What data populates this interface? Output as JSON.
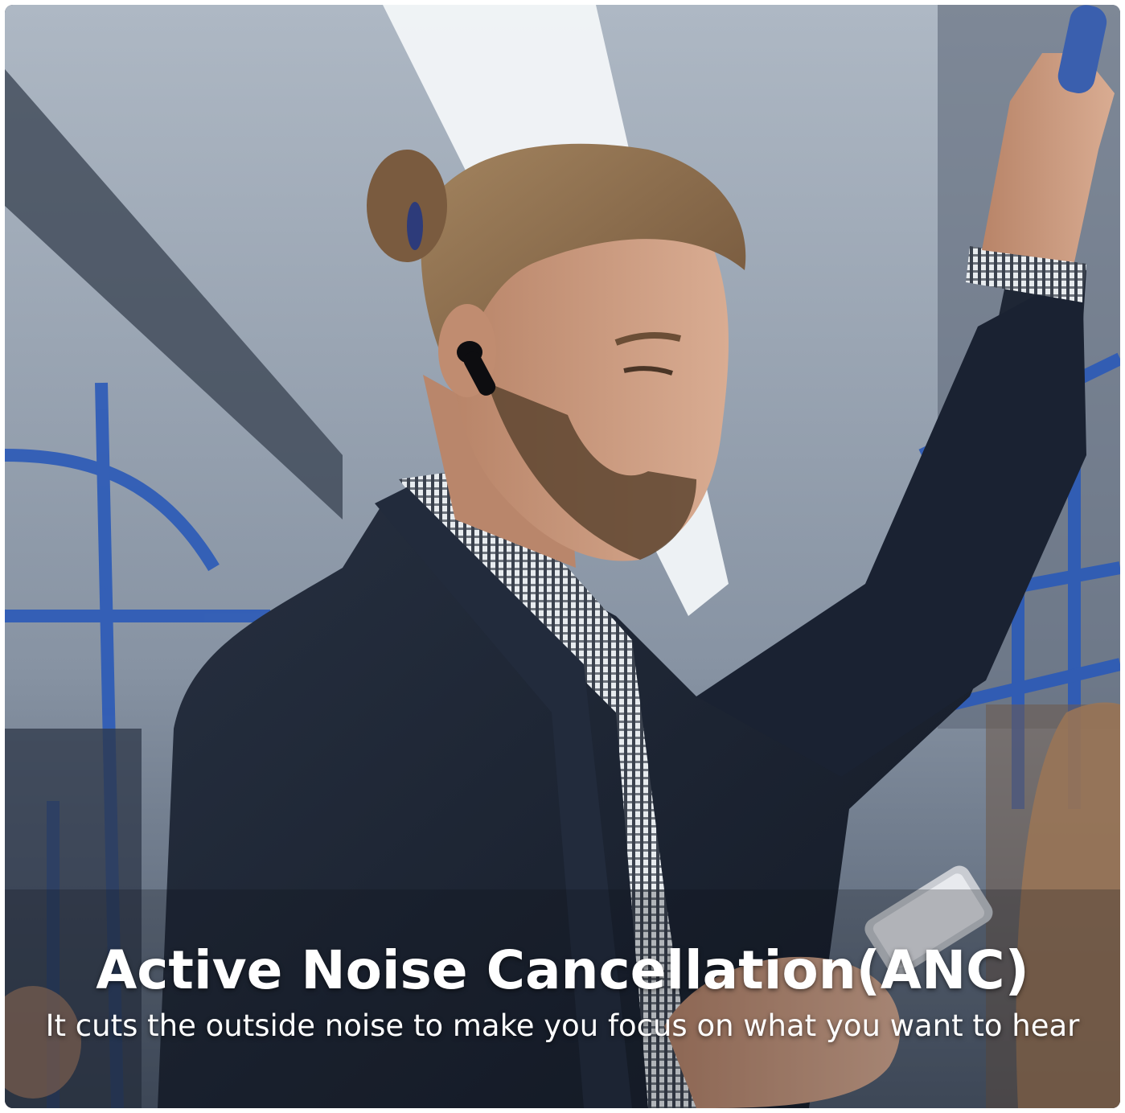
{
  "scene": {
    "description_icon": "man-with-earbuds-photo",
    "colors": {
      "ceiling": "#9aa6b5",
      "ceiling_light": "#f4f7fa",
      "rail_blue": "#2b5ab8",
      "jacket": "#1c2433",
      "skin": "#c99a80",
      "hair": "#8a6a4b",
      "earbud": "#0d0d10"
    }
  },
  "caption": {
    "headline": "Active Noise Cancellation(ANC)",
    "subline": "It cuts the outside noise to make you focus on what you want to hear"
  }
}
